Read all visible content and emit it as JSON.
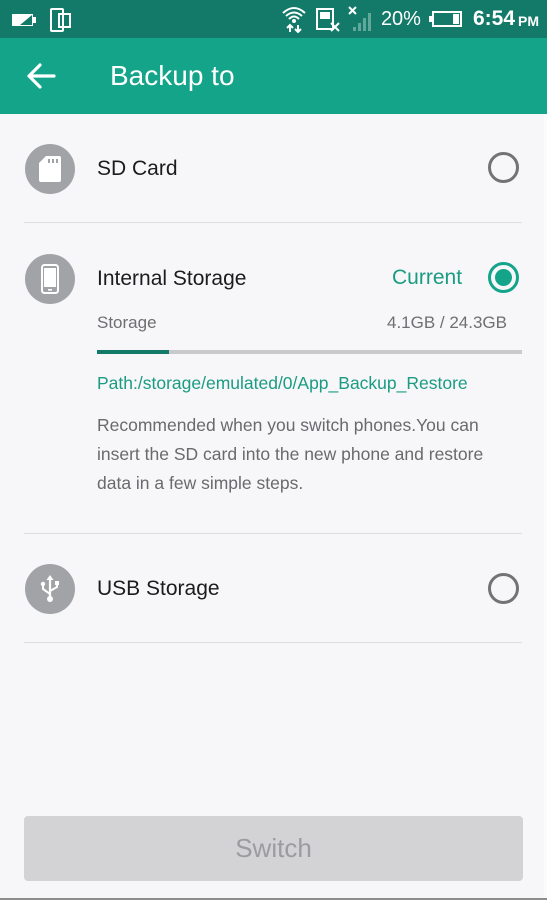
{
  "status_bar": {
    "battery_percent": "20%",
    "time": "6:54",
    "ampm": "PM",
    "icons": [
      "battery-saver-icon",
      "device-icon",
      "wifi-data-icon",
      "sim-missing-icon",
      "signal-no-service-icon",
      "battery-icon"
    ]
  },
  "app_bar": {
    "back_icon": "arrow-left-icon",
    "title": "Backup to"
  },
  "options": [
    {
      "label": "SD Card",
      "icon": "sd-card-icon",
      "selected": false
    },
    {
      "label": "Internal Storage",
      "icon": "phone-icon",
      "selected": true,
      "current_label": "Current",
      "storage_label": "Storage",
      "storage_value": "4.1GB / 24.3GB",
      "storage_used_fraction": 0.169,
      "path": "Path:/storage/emulated/0/App_Backup_Restore",
      "description": "Recommended when you switch phones.You can insert the SD card into the new phone and restore data in a few simple steps."
    },
    {
      "label": "USB Storage",
      "icon": "usb-icon",
      "selected": false
    }
  ],
  "switch_button": {
    "label": "Switch",
    "enabled": false
  },
  "colors": {
    "accent": "#14a48a",
    "status_bar": "#137a69",
    "progress": "#137a69"
  }
}
